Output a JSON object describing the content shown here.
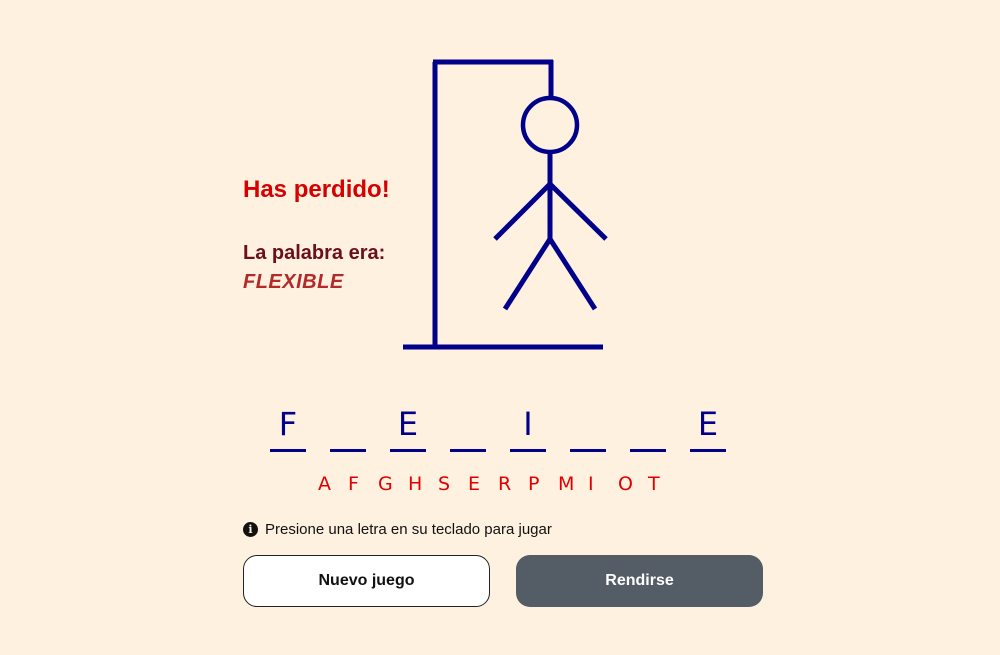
{
  "status": {
    "title": "Has perdido!",
    "reveal_label": "La palabra era:",
    "reveal_word": "FLEXIBLE"
  },
  "word_slots": [
    "F",
    "",
    "E",
    "",
    "I",
    "",
    "",
    "E"
  ],
  "used_letters": [
    "A",
    "F",
    "G",
    "H",
    "S",
    "E",
    "R",
    "P",
    "M",
    "I",
    "O",
    "T"
  ],
  "hint": {
    "icon": "info-icon",
    "text": "Presione una letra en su teclado para jugar"
  },
  "buttons": {
    "new_game": "Nuevo juego",
    "give_up": "Rendirse"
  },
  "colors": {
    "background": "#fff1e0",
    "drawing": "#00008b",
    "lost_title": "#d50000",
    "used_letters": "#e00000",
    "give_up_button": "#545c66"
  }
}
